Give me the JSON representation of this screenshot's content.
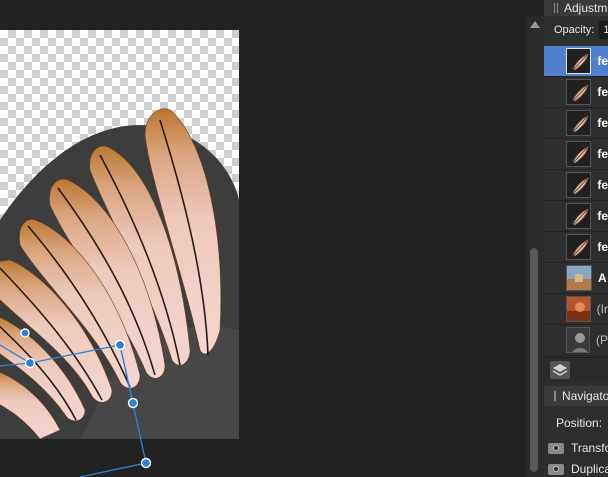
{
  "window": {
    "close_glyph": "✕"
  },
  "panel": {
    "tab_title": "Adjustm",
    "opacity_label": "Opacity:",
    "opacity_value": "10",
    "layers": [
      {
        "name": "fe",
        "selected": true,
        "thumb": "feather"
      },
      {
        "name": "fe",
        "selected": false,
        "thumb": "feather"
      },
      {
        "name": "fe",
        "selected": false,
        "thumb": "feather"
      },
      {
        "name": "fe",
        "selected": false,
        "thumb": "feather"
      },
      {
        "name": "fe",
        "selected": false,
        "thumb": "feather"
      },
      {
        "name": "fe",
        "selected": false,
        "thumb": "feather"
      },
      {
        "name": "fe",
        "selected": false,
        "thumb": "feather"
      },
      {
        "name": "A",
        "selected": false,
        "thumb": "photo"
      },
      {
        "name": "(Ir",
        "selected": false,
        "thumb": "photo-warm"
      },
      {
        "name": "(P",
        "selected": false,
        "thumb": "portrait"
      }
    ],
    "navigator_title": "Navigato",
    "position_label": "Position:",
    "history": [
      "Transfo",
      "Duplica"
    ]
  },
  "colors": {
    "selection": "#4f7fcd",
    "panel_bg": "#2e2e2e",
    "canvas_bg": "#222222",
    "handle": "#2f80d6"
  },
  "icons": {
    "layers_stack": "layers-stack-icon",
    "history_item": "camera-icon"
  }
}
